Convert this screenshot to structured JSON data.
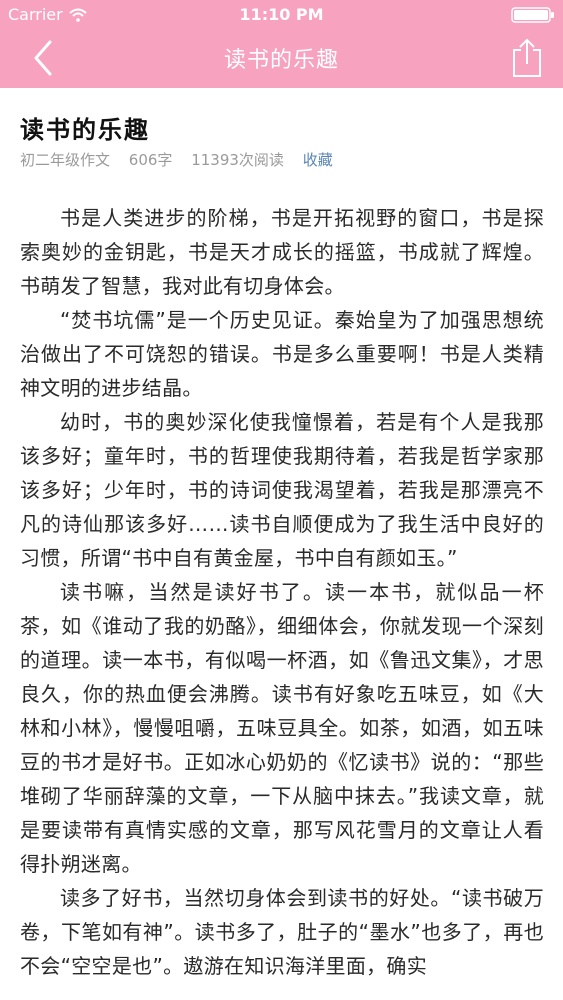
{
  "status_bar": {
    "carrier": "Carrier",
    "time": "11:10 PM"
  },
  "nav": {
    "title": "读书的乐趣"
  },
  "article": {
    "title": "读书的乐趣",
    "category": "初二年级作文",
    "word_count": "606字",
    "reads": "11393次阅读",
    "favorite": "收藏",
    "paragraphs": [
      "书是人类进步的阶梯，书是开拓视野的窗口，书是探索奥妙的金钥匙，书是天才成长的摇篮，书成就了辉煌。书萌发了智慧，我对此有切身体会。",
      "“焚书坑儒”是一个历史见证。秦始皇为了加强思想统治做出了不可饶恕的错误。书是多么重要啊！书是人类精神文明的进步结晶。",
      "幼时，书的奥妙深化使我憧憬着，若是有个人是我那该多好；童年时，书的哲理使我期待着，若我是哲学家那该多好；少年时，书的诗词使我渴望着，若我是那漂亮不凡的诗仙那该多好……读书自顺便成为了我生活中良好的习惯，所谓“书中自有黄金屋，书中自有颜如玉。”",
      "读书嘛，当然是读好书了。读一本书，就似品一杯茶，如《谁动了我的奶酪》，细细体会，你就发现一个深刻的道理。读一本书，有似喝一杯酒，如《鲁迅文集》，才思良久，你的热血便会沸腾。读书有好象吃五味豆，如《大林和小林》，慢慢咀嚼，五味豆具全。如茶，如酒，如五味豆的书才是好书。正如冰心奶奶的《忆读书》说的：“那些堆砌了华丽辞藻的文章，一下从脑中抹去。”我读文章，就是要读带有真情实感的文章，那写风花雪月的文章让人看得扑朔迷离。",
      "读多了好书，当然切身体会到读书的好处。“读书破万卷，下笔如有神”。读书多了，肚子的“墨水”也多了，再也不会“空空是也”。遨游在知识海洋里面，确实"
    ]
  },
  "icons": {
    "back": "chevron-left-icon",
    "share": "share-icon",
    "wifi": "wifi-icon",
    "battery": "battery-icon"
  },
  "colors": {
    "nav_background": "#f7a3c0",
    "favorite_link": "#5b85b8",
    "meta_text": "#9a9a9a"
  }
}
